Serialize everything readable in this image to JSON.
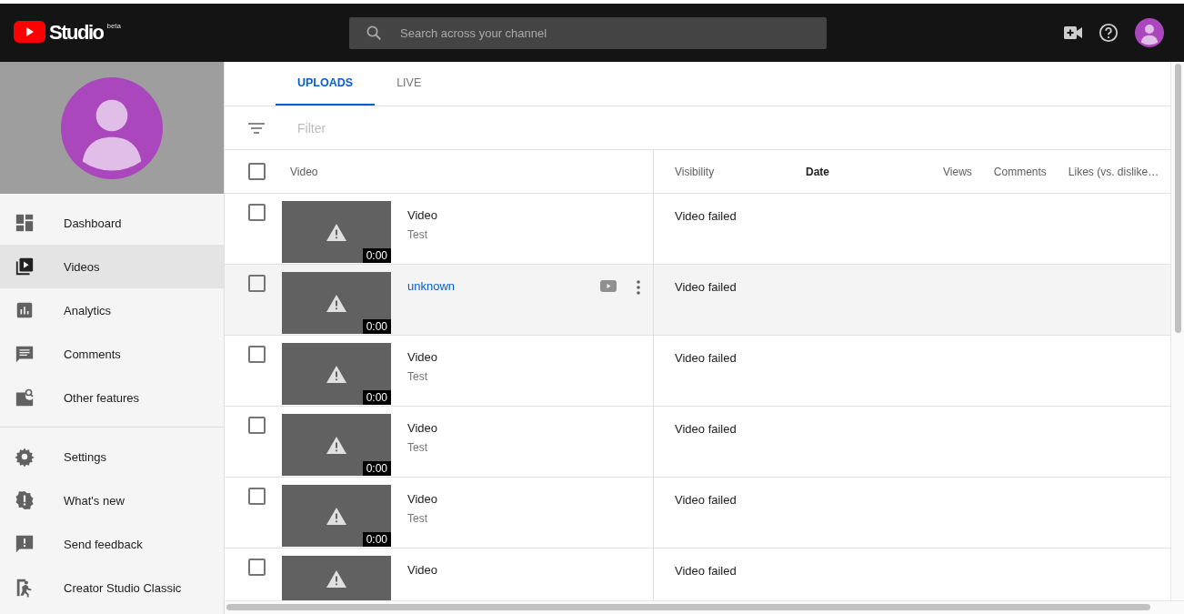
{
  "topbar": {
    "logo": {
      "text": "Studio",
      "badge": "beta"
    },
    "search": {
      "placeholder": "Search across your channel"
    }
  },
  "sidebar": {
    "primary": [
      {
        "label": "Dashboard",
        "kind": "dashboard",
        "selected": false
      },
      {
        "label": "Videos",
        "kind": "videos",
        "selected": true
      },
      {
        "label": "Analytics",
        "kind": "analytics",
        "selected": false
      },
      {
        "label": "Comments",
        "kind": "comments",
        "selected": false
      },
      {
        "label": "Other features",
        "kind": "other",
        "selected": false
      }
    ],
    "secondary": [
      {
        "label": "Settings",
        "kind": "settings",
        "selected": false
      },
      {
        "label": "What's new",
        "kind": "new",
        "selected": false
      },
      {
        "label": "Send feedback",
        "kind": "feedback",
        "selected": false
      },
      {
        "label": "Creator Studio Classic",
        "kind": "classic",
        "selected": false
      }
    ]
  },
  "tabs": [
    {
      "label": "UPLOADS",
      "selected": true
    },
    {
      "label": "LIVE",
      "selected": false
    }
  ],
  "filter": {
    "placeholder": "Filter"
  },
  "table": {
    "video_column": {
      "label": "Video",
      "checked": false
    },
    "columns": [
      {
        "label": "Visibility",
        "sorted": false
      },
      {
        "label": "Date",
        "sorted": true
      },
      {
        "label": "Views",
        "sorted": false
      },
      {
        "label": "Comments",
        "sorted": false
      },
      {
        "label": "Likes (vs. dislike…",
        "sorted": false
      }
    ],
    "rows": [
      {
        "title": "Video",
        "subtitle": "Test",
        "duration": "0:00",
        "visibility": "Video failed",
        "checked": false,
        "hovered": false
      },
      {
        "title": "unknown",
        "duration": "0:00",
        "visibility": "Video failed",
        "checked": false,
        "hovered": true
      },
      {
        "title": "Video",
        "subtitle": "Test",
        "duration": "0:00",
        "visibility": "Video failed",
        "checked": false,
        "hovered": false
      },
      {
        "title": "Video",
        "subtitle": "Test",
        "duration": "0:00",
        "visibility": "Video failed",
        "checked": false,
        "hovered": false
      },
      {
        "title": "Video",
        "subtitle": "Test",
        "duration": "0:00",
        "visibility": "Video failed",
        "checked": false,
        "hovered": false
      },
      {
        "title": "Video",
        "visibility": "Video failed",
        "checked": false,
        "hovered": false
      }
    ]
  }
}
